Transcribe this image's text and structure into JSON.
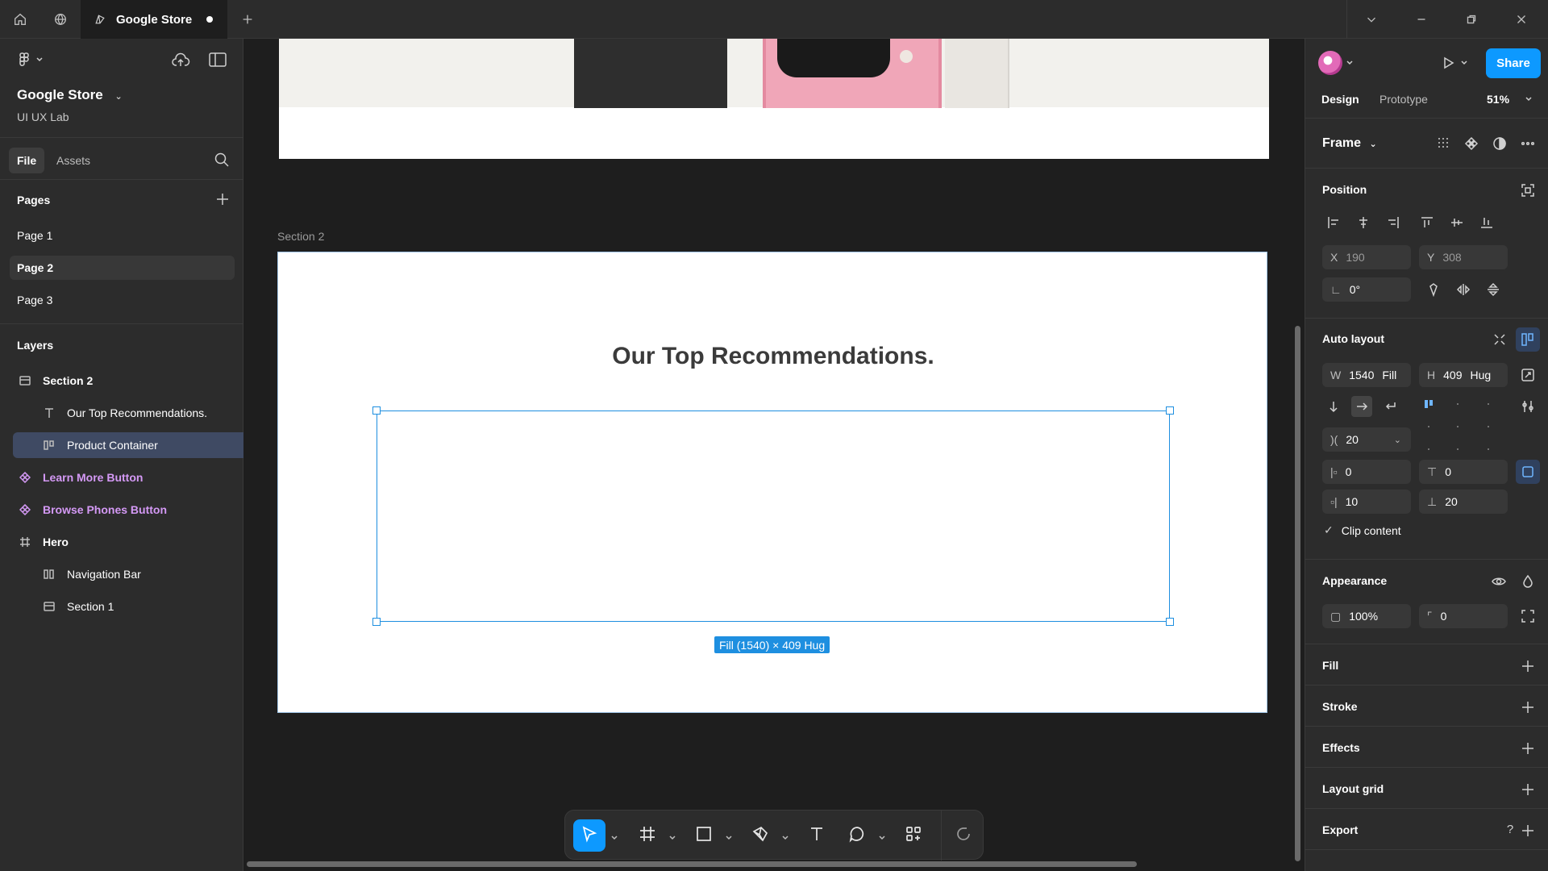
{
  "window": {
    "tab_title": "Google Store"
  },
  "file": {
    "name": "Google Store",
    "team": "UI UX Lab"
  },
  "left_panel": {
    "tabs": [
      "File",
      "Assets"
    ],
    "pages_title": "Pages",
    "pages": [
      "Page 1",
      "Page 2",
      "Page 3"
    ],
    "selected_page": "Page 2",
    "layers_title": "Layers",
    "layers": [
      {
        "label": "Section 2",
        "icon": "section-icon"
      },
      {
        "label": "Our Top Recommendations.",
        "icon": "text-icon"
      },
      {
        "label": "Product Container",
        "icon": "autolayout-icon"
      },
      {
        "label": "Learn More Button",
        "icon": "component-icon"
      },
      {
        "label": "Browse Phones Button",
        "icon": "component-icon"
      },
      {
        "label": "Hero",
        "icon": "frame-icon"
      },
      {
        "label": "Navigation Bar",
        "icon": "autolayout-icon"
      },
      {
        "label": "Section 1",
        "icon": "section-icon"
      }
    ]
  },
  "canvas": {
    "section_label": "Section 2",
    "heading": "Our Top Recommendations.",
    "size_tag": "Fill (1540) × 409 Hug"
  },
  "right_panel": {
    "share_label": "Share",
    "tabs": [
      "Design",
      "Prototype"
    ],
    "zoom": "51%",
    "frame_label": "Frame",
    "position": {
      "title": "Position",
      "x_label": "X",
      "x": "190",
      "y_label": "Y",
      "y": "308",
      "rotation": "0°"
    },
    "auto_layout": {
      "title": "Auto layout",
      "w_label": "W",
      "w": "1540",
      "w_mode": "Fill",
      "h_label": "H",
      "h": "409",
      "h_mode": "Hug",
      "gap": "20",
      "padding_left": "0",
      "padding_top": "0",
      "padding_right": "10",
      "padding_bottom": "20",
      "clip_label": "Clip content"
    },
    "appearance": {
      "title": "Appearance",
      "opacity": "100%",
      "radius": "0"
    },
    "sections": [
      "Fill",
      "Stroke",
      "Effects",
      "Layout grid",
      "Export"
    ],
    "help": "?"
  },
  "colors": {
    "accent": "#0d99ff",
    "component": "#d499f5",
    "panel": "#2c2c2c",
    "canvas": "#1e1e1e"
  }
}
